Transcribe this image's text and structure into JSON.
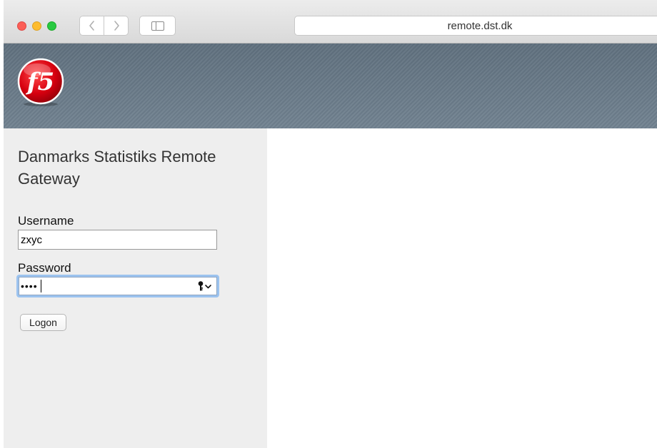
{
  "browser": {
    "url": "remote.dst.dk",
    "back_icon": "chevron-left-icon",
    "forward_icon": "chevron-right-icon",
    "sidebar_icon": "sidebar-icon",
    "traffic_light_colors": [
      "#fc5f57",
      "#fdbc2e",
      "#29c941"
    ]
  },
  "header": {
    "logo_text": "f5",
    "background_color": "#687a89",
    "logo_color": "#d7000f"
  },
  "login": {
    "title": "Danmarks Statistiks Remote Gateway",
    "username_label": "Username",
    "username_value": "zxyc",
    "password_label": "Password",
    "password_value": "••••",
    "password_icon": "key-dropdown-icon",
    "logon_label": "Logon"
  }
}
